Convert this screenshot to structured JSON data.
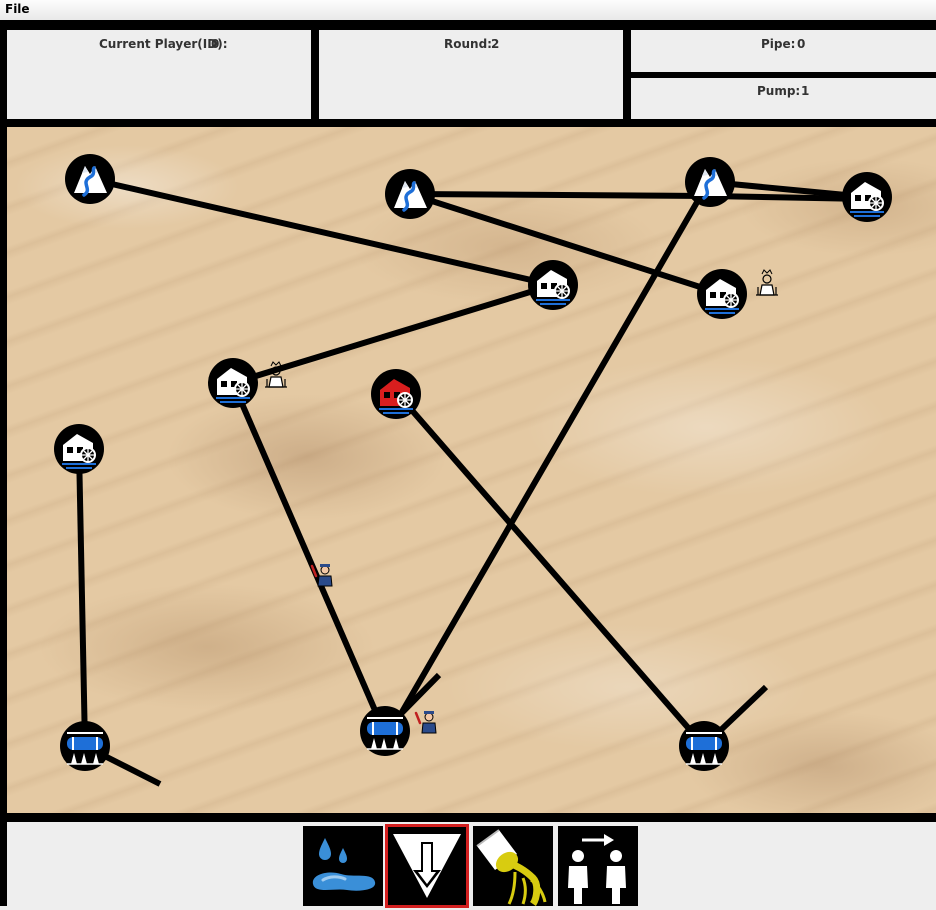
{
  "menu": {
    "file_label": "File"
  },
  "status": {
    "current_player_label": "Current Player(ID):",
    "current_player_value": "0",
    "round_label": "Round:",
    "round_value": "2",
    "pipe_label": "Pipe:",
    "pipe_value": "0",
    "pump_label": "Pump:",
    "pump_value": "1"
  },
  "board": {
    "nodes": [
      {
        "id": "spring-1",
        "type": "spring",
        "icon": "mountain-spring-icon"
      },
      {
        "id": "spring-2",
        "type": "spring",
        "icon": "mountain-spring-icon"
      },
      {
        "id": "spring-3",
        "type": "spring",
        "icon": "mountain-spring-icon"
      },
      {
        "id": "pump-1",
        "type": "pump",
        "icon": "pump-station-icon"
      },
      {
        "id": "pump-2",
        "type": "pump",
        "icon": "pump-station-icon"
      },
      {
        "id": "pump-3",
        "type": "pump",
        "icon": "pump-station-icon"
      },
      {
        "id": "pump-4",
        "type": "pump",
        "icon": "pump-station-icon"
      },
      {
        "id": "pump-5",
        "type": "pump",
        "icon": "pump-station-icon",
        "state": "broken"
      },
      {
        "id": "pump-6",
        "type": "pump",
        "icon": "pump-station-icon"
      },
      {
        "id": "cistern-1",
        "type": "cistern",
        "icon": "cistern-tank-icon"
      },
      {
        "id": "cistern-2",
        "type": "cistern",
        "icon": "cistern-tank-icon"
      },
      {
        "id": "cistern-3",
        "type": "cistern",
        "icon": "cistern-tank-icon"
      }
    ],
    "players": [
      {
        "id": "saboteur-1",
        "icon": "saboteur-icon"
      },
      {
        "id": "saboteur-2",
        "icon": "saboteur-icon"
      },
      {
        "id": "plumber-1",
        "icon": "plumber-icon"
      },
      {
        "id": "plumber-2",
        "icon": "plumber-icon"
      }
    ],
    "colors": {
      "broken": "#d81e1e",
      "water": "#1e6fd8",
      "node_bg": "#000000"
    }
  },
  "actions": [
    {
      "id": "leak",
      "icon": "water-puddle-icon"
    },
    {
      "id": "move-down",
      "icon": "down-arrow-icon",
      "selected": true
    },
    {
      "id": "sticky",
      "icon": "sticky-pipe-icon"
    },
    {
      "id": "pass",
      "icon": "pass-turn-icon"
    }
  ]
}
